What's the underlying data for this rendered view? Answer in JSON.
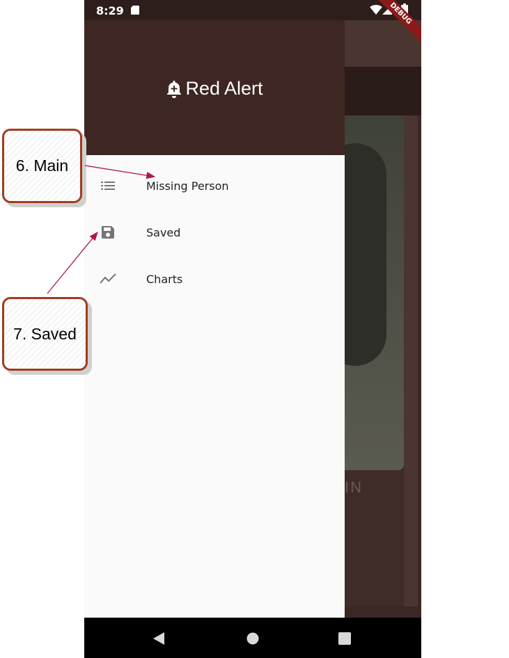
{
  "status_bar": {
    "time": "8:29",
    "debug_label": "DEBUG"
  },
  "drawer": {
    "title": "Red Alert",
    "items": [
      {
        "label": "Missing Person",
        "icon": "list-icon"
      },
      {
        "label": "Saved",
        "icon": "save-icon"
      },
      {
        "label": "Charts",
        "icon": "trending-icon"
      }
    ]
  },
  "background": {
    "name_fragment": "IN"
  },
  "callouts": [
    {
      "label": "6. Main"
    },
    {
      "label": "7. Saved"
    }
  ],
  "colors": {
    "header": "#3e2723",
    "drawer_bg": "#fafafa",
    "icon": "#757575",
    "callout_border": "#a33a1e",
    "arrow": "#b0164a"
  }
}
